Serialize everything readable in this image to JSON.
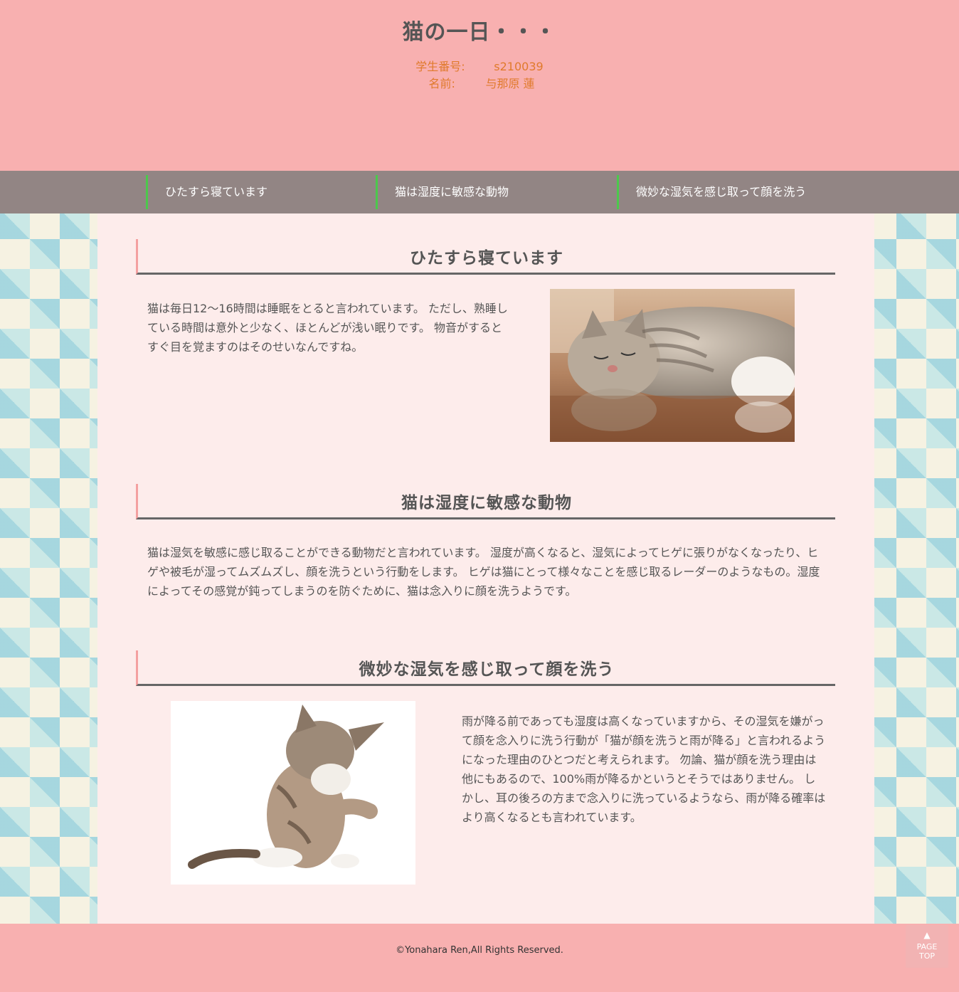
{
  "header": {
    "title": "猫の一日・・・",
    "student_id_label": "学生番号:",
    "student_id": "s210039",
    "name_label": "名前:",
    "name": "与那原 蓮"
  },
  "nav": {
    "items": [
      {
        "label": "ひたすら寝ています"
      },
      {
        "label": "猫は湿度に敏感な動物"
      },
      {
        "label": "微妙な湿気を感じ取って顔を洗う"
      }
    ]
  },
  "sections": [
    {
      "heading": "ひたすら寝ています",
      "text": "猫は毎日12〜16時間は睡眠をとると言われています。 ただし、熟睡している時間は意外と少なく、ほとんどが浅い眠りです。 物音がするとすぐ目を覚ますのはそのせいなんですね。"
    },
    {
      "heading": "猫は湿度に敏感な動物",
      "text": "猫は湿気を敏感に感じ取ることができる動物だと言われています。 湿度が高くなると、湿気によってヒゲに張りがなくなったり、ヒゲや被毛が湿ってムズムズし、顔を洗うという行動をします。 ヒゲは猫にとって様々なことを感じ取るレーダーのようなもの。湿度によってその感覚が鈍ってしまうのを防ぐために、猫は念入りに顔を洗うようです。"
    },
    {
      "heading": "微妙な湿気を感じ取って顔を洗う",
      "text": "雨が降る前であっても湿度は高くなっていますから、その湿気を嫌がって顔を念入りに洗う行動が「猫が顔を洗うと雨が降る」と言われるようになった理由のひとつだと考えられます。 勿論、猫が顔を洗う理由は他にもあるので、100%雨が降るかというとそうではありません。 しかし、耳の後ろの方まで念入りに洗っているようなら、雨が降る確率はより高くなるとも言われています。"
    }
  ],
  "footer": {
    "copyright": "©Yonahara Ren,All Rights Reserved.",
    "page_top_line1": "PAGE",
    "page_top_line2": "TOP"
  },
  "colors": {
    "header_bg": "#f8b0b0",
    "nav_bg": "#928584",
    "nav_accent": "#4cc84c",
    "content_bg": "#fdeceb",
    "student_info": "#e07a2c"
  }
}
